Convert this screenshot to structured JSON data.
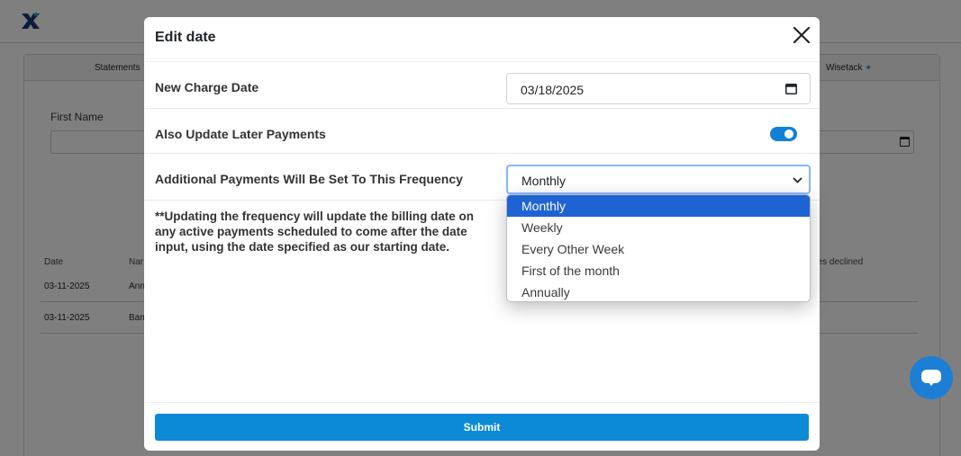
{
  "background": {
    "tabs": {
      "statements": "Statements",
      "wisetack": "Wisetack",
      "wisetack_icon": "sparkle-icon"
    },
    "form": {
      "first_name_label": "First Name"
    },
    "table": {
      "columns": {
        "date": "Date",
        "name": "Nar",
        "declined": "nes declined"
      },
      "rows": [
        {
          "date": "03-11-2025",
          "name": "Ann"
        },
        {
          "date": "03-11-2025",
          "name": "Barr"
        }
      ]
    }
  },
  "modal": {
    "title": "Edit date",
    "close_icon": "close-icon",
    "new_charge_date": {
      "label": "New Charge Date",
      "value": "03/18/2025"
    },
    "update_later": {
      "label": "Also Update Later Payments",
      "enabled": true
    },
    "frequency": {
      "label": "Additional Payments Will Be Set To This Frequency",
      "selected": "Monthly",
      "options": [
        "Monthly",
        "Weekly",
        "Every Other Week",
        "First of the month",
        "Annually"
      ]
    },
    "note": "**Updating the frequency will update the billing date on any active payments scheduled to come after the date input, using the date specified as our starting date.",
    "submit_label": "Submit"
  },
  "colors": {
    "primary": "#0d8ad6",
    "toggle": "#1181d8",
    "selected_option": "#1e63d3",
    "chat": "#1c7fd4"
  }
}
